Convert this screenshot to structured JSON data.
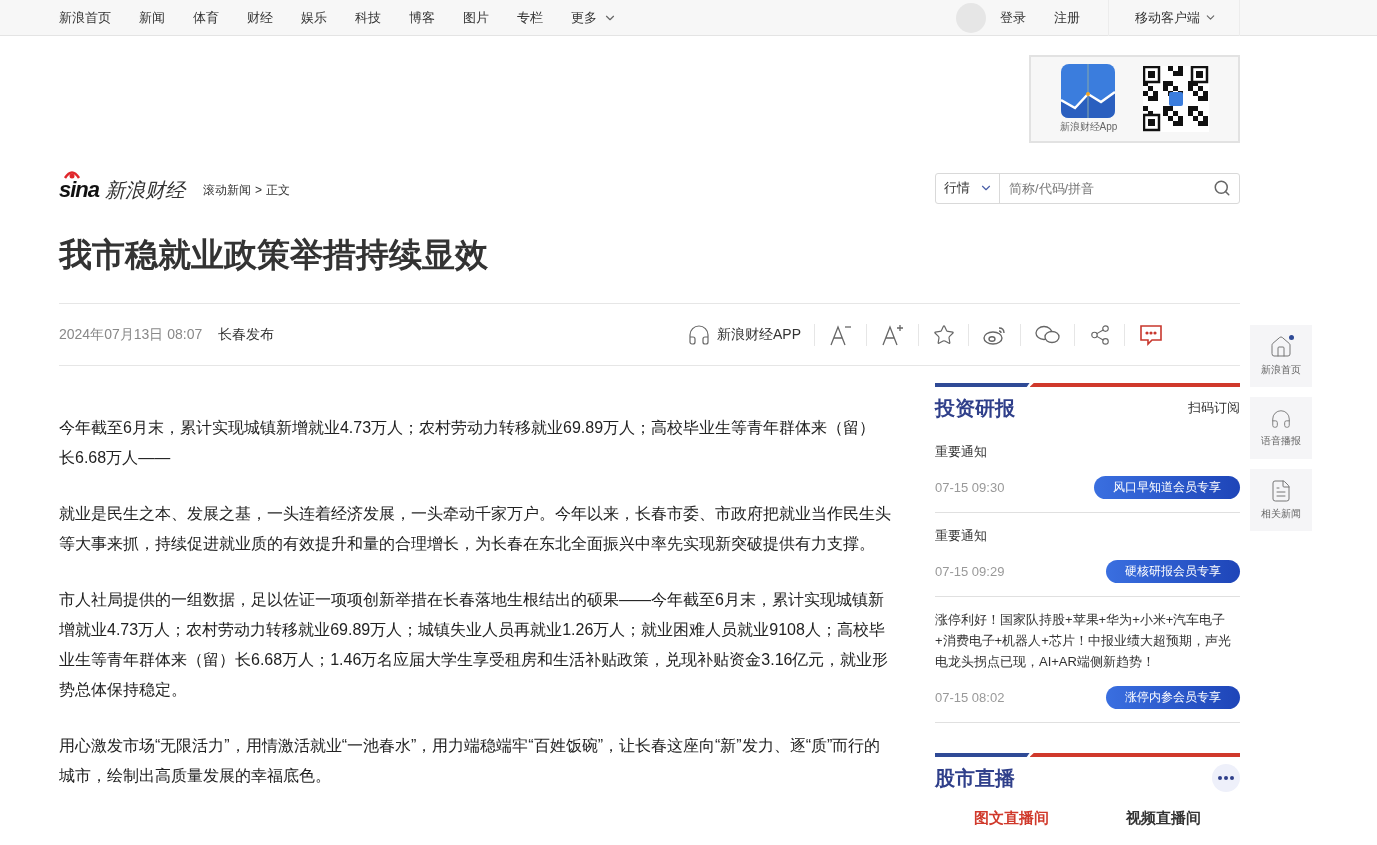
{
  "top_nav": {
    "links": [
      "新浪首页",
      "新闻",
      "体育",
      "财经",
      "娱乐",
      "科技",
      "博客",
      "图片",
      "专栏"
    ],
    "more": "更多",
    "login": "登录",
    "register": "注册",
    "mobile": "移动客户端"
  },
  "app_promo": {
    "label": "新浪财经App"
  },
  "header": {
    "logo_mark": "sina",
    "logo_text": "新浪财经",
    "breadcrumb": [
      "滚动新闻",
      "正文"
    ],
    "separator": ">"
  },
  "search": {
    "market": "行情",
    "placeholder": "简称/代码/拼音"
  },
  "article": {
    "title": "我市稳就业政策举措持续显效",
    "date": "2024年07月13日 08:07",
    "source": "长春发布",
    "app_label": "新浪财经APP",
    "paragraphs": [
      "今年截至6月末，累计实现城镇新增就业4.73万人；农村劳动力转移就业69.89万人；高校毕业生等青年群体来（留）长6.68万人——",
      "就业是民生之本、发展之基，一头连着经济发展，一头牵动千家万户。今年以来，长春市委、市政府把就业当作民生头等大事来抓，持续促进就业质的有效提升和量的合理增长，为长春在东北全面振兴中率先实现新突破提供有力支撑。",
      "市人社局提供的一组数据，足以佐证一项项创新举措在长春落地生根结出的硕果——今年截至6月末，累计实现城镇新增就业4.73万人；农村劳动力转移就业69.89万人；城镇失业人员再就业1.26万人；就业困难人员就业9108人；高校毕业生等青年群体来（留）长6.68万人；1.46万名应届大学生享受租房和生活补贴政策，兑现补贴资金3.16亿元，就业形势总体保持稳定。",
      "用心激发市场“无限活力”，用情激活就业“一池春水”，用力端稳端牢“百姓饭碗”，让长春这座向“新”发力、逐“质”而行的城市，绘制出高质量发展的幸福底色。"
    ]
  },
  "research": {
    "title": "投资研报",
    "subscribe": "扫码订阅",
    "items": [
      {
        "title": "重要通知",
        "time": "07-15 09:30",
        "tag": "风口早知道会员专享"
      },
      {
        "title": "重要通知",
        "time": "07-15 09:29",
        "tag": "硬核研报会员专享"
      },
      {
        "title": "涨停利好！国家队持股+苹果+华为+小米+汽车电子+消费电子+机器人+芯片！中报业绩大超预期，声光电龙头拐点已现，AI+AR端侧新趋势！",
        "time": "07-15 08:02",
        "tag": "涨停内参会员专享"
      }
    ]
  },
  "live": {
    "title": "股市直播",
    "tabs": [
      {
        "label": "图文直播间",
        "selected": true
      },
      {
        "label": "视频直播间",
        "selected": false
      }
    ]
  },
  "side_nav": [
    {
      "kind": "home",
      "label": "新浪首页"
    },
    {
      "kind": "audio",
      "label": "语音播报"
    },
    {
      "kind": "list",
      "label": "相关新闻"
    }
  ]
}
